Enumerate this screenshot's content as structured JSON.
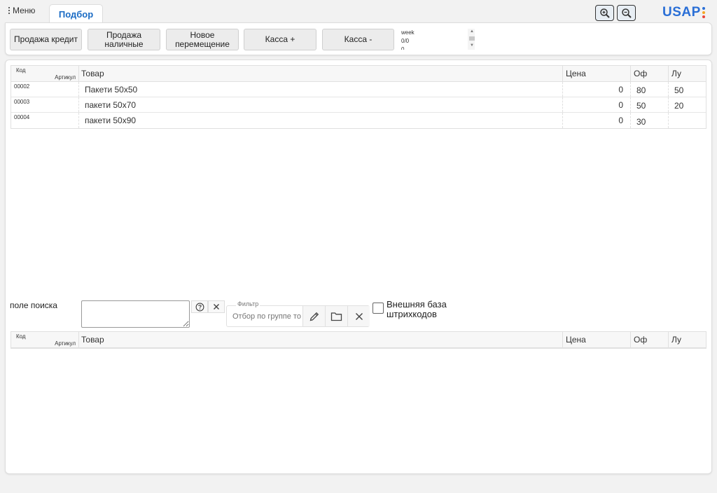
{
  "topbar": {
    "menu_label": "Меню",
    "tab_label": "Подбор",
    "logo_text": "USAP",
    "logo_colors": [
      "#2a6fd6",
      "#f5a623",
      "#e8453c"
    ]
  },
  "toolbar": {
    "buttons": [
      {
        "label": "Продажа кредит"
      },
      {
        "label": "Продажа\nналичные"
      },
      {
        "label": "Новое\nперемещение"
      },
      {
        "label": "Касса +"
      },
      {
        "label": "Касса -"
      }
    ],
    "week_lines": [
      "week",
      "0/0",
      "0"
    ]
  },
  "grid_columns": {
    "code": "Код",
    "article": "Артикул",
    "name": "Товар",
    "price": "Цена",
    "of": "Оф",
    "lu": "Лу"
  },
  "top_grid": {
    "rows": [
      {
        "code": "00002",
        "name": "Пакети 50х50",
        "price": "0",
        "of": "80",
        "lu": "50"
      },
      {
        "code": "00003",
        "name": "пакети 50х70",
        "price": "0",
        "of": "50",
        "lu": "20"
      },
      {
        "code": "00004",
        "name": "пакети 50х90",
        "price": "0",
        "of": "30",
        "lu": ""
      }
    ]
  },
  "search": {
    "label": "поле поиска",
    "value": "",
    "filter_legend": "Фильтр",
    "filter_placeholder": "Отбор по группе то",
    "external_db_label": "Внешняя база штрихкодов",
    "external_db_checked": false
  },
  "icons": {
    "zoom_in": "zoom-in-icon",
    "zoom_out": "zoom-out-icon",
    "help": "help-icon",
    "clear": "close-icon",
    "edit": "pencil-icon",
    "folder": "folder-icon"
  }
}
